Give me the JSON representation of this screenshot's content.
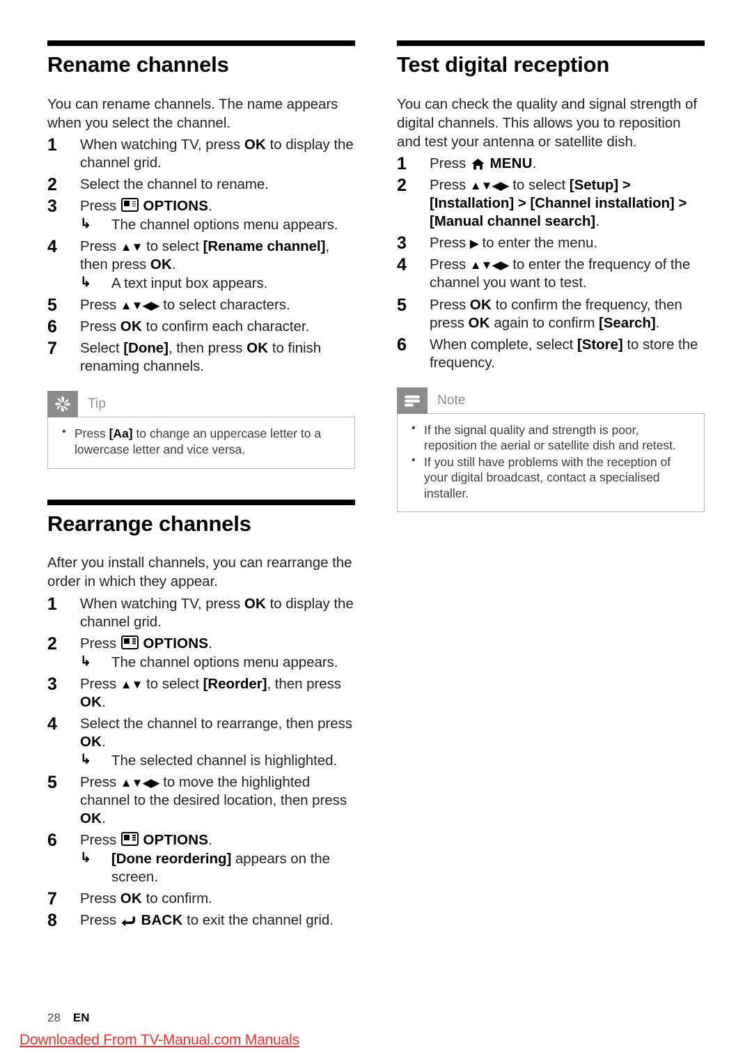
{
  "page": {
    "number": "28",
    "language": "EN",
    "watermark": "Downloaded From TV-Manual.com Manuals",
    "watermark_color": "#ff2a2a"
  },
  "left_column": {
    "sections": [
      {
        "id": "rename-channels",
        "heading": "Rename channels",
        "intro": "You can rename channels. The name appears when you select the channel.",
        "steps": [
          {
            "num": "1",
            "text_pre": "When watching TV, press ",
            "kbd": "OK",
            "text_post": " to display the channel grid."
          },
          {
            "num": "2",
            "text_pre": "Select the channel to rename.",
            "kbd": "",
            "text_post": ""
          },
          {
            "num": "3",
            "text_pre": "Press ",
            "icon": "options-icon",
            "kbd": "OPTIONS",
            "text_post": ".",
            "sub": "The channel options menu appears."
          },
          {
            "num": "4",
            "text_pre": "Press ",
            "arrows": "▲▼",
            "mid": " to select ",
            "bracket": "[Rename channel]",
            "text_post": ", then press ",
            "kbd": "OK",
            "tail": ".",
            "sub": "A text input box appears."
          },
          {
            "num": "5",
            "text_pre": "Press ",
            "arrows": "▲▼◀▶",
            "mid": " to select characters.",
            "kbd": "",
            "text_post": ""
          },
          {
            "num": "6",
            "text_pre": "Press ",
            "kbd": "OK",
            "text_post": " to confirm each character."
          },
          {
            "num": "7",
            "text_pre": "Select ",
            "bracket": "[Done]",
            "mid": ", then press ",
            "kbd": "OK",
            "text_post": " to finish renaming channels."
          }
        ],
        "callout": {
          "type": "tip",
          "icon": "asterisk-icon",
          "title": "Tip",
          "items": [
            {
              "pre": "Press ",
              "bold": "[Aa]",
              "post": " to change an uppercase letter to a lowercase letter and vice versa."
            }
          ]
        }
      },
      {
        "id": "rearrange-channels",
        "heading": "Rearrange channels",
        "intro": "After you install channels, you can rearrange the order in which they appear.",
        "steps": [
          {
            "num": "1",
            "text_pre": "When watching TV, press ",
            "kbd": "OK",
            "text_post": " to display the channel grid."
          },
          {
            "num": "2",
            "text_pre": "Press ",
            "icon": "options-icon",
            "kbd": "OPTIONS",
            "text_post": ".",
            "sub": "The channel options menu appears."
          },
          {
            "num": "3",
            "text_pre": "Press ",
            "arrows": "▲▼",
            "mid": " to select ",
            "bracket": "[Reorder]",
            "text_post": ", then press ",
            "kbd": "OK",
            "tail": "."
          },
          {
            "num": "4",
            "text_pre": "Select the channel to rearrange, then press ",
            "kbd": "OK",
            "text_post": ".",
            "sub": "The selected channel is highlighted."
          },
          {
            "num": "5",
            "text_pre": "Press ",
            "arrows": "▲▼◀▶",
            "mid": " to move the highlighted channel to the desired location, then press ",
            "kbd": "OK",
            "tail": "."
          },
          {
            "num": "6",
            "text_pre": "Press ",
            "icon": "options-icon",
            "kbd": "OPTIONS",
            "text_post": ".",
            "sub_bold": "[Done reordering]",
            "sub": " appears on the screen."
          },
          {
            "num": "7",
            "text_pre": "Press ",
            "kbd": "OK",
            "text_post": " to confirm."
          },
          {
            "num": "8",
            "text_pre": "Press ",
            "icon": "back-icon",
            "kbd": "BACK",
            "text_post": " to exit the channel grid."
          }
        ]
      }
    ]
  },
  "right_column": {
    "sections": [
      {
        "id": "test-digital-reception",
        "heading": "Test digital reception",
        "intro": "You can check the quality and signal strength of digital channels. This allows you to reposition and test your antenna or satellite dish.",
        "steps": [
          {
            "num": "1",
            "text_pre": "Press ",
            "icon": "home-icon",
            "kbd": "MENU",
            "text_post": "."
          },
          {
            "num": "2",
            "text_pre": "Press ",
            "arrows": "▲▼◀▶",
            "mid": " to select ",
            "path": "[Setup] > [Installation] > [Channel installation] > [Manual channel search]",
            "tail": "."
          },
          {
            "num": "3",
            "text_pre": "Press ",
            "arrows": "▶",
            "mid": " to enter the menu."
          },
          {
            "num": "4",
            "text_pre": "Press ",
            "arrows": "▲▼◀▶",
            "mid": " to enter the frequency of the channel you want to test."
          },
          {
            "num": "5",
            "text_pre": "Press ",
            "kbd": "OK",
            "mid": " to confirm the frequency, then press ",
            "kbd2": "OK",
            "mid2": " again to confirm ",
            "bracket": "[Search]",
            "tail": "."
          },
          {
            "num": "6",
            "text_pre": "When complete, select ",
            "bracket": "[Store]",
            "mid": " to store the frequency."
          }
        ],
        "callout": {
          "type": "note",
          "icon": "note-lines-icon",
          "title": "Note",
          "items": [
            {
              "pre": "If the signal quality and strength is poor, reposition the aerial or satellite dish and retest.",
              "bold": "",
              "post": ""
            },
            {
              "pre": "If you still have problems with the reception of your digital broadcast, contact a specialised installer.",
              "bold": "",
              "post": ""
            }
          ]
        }
      }
    ]
  }
}
